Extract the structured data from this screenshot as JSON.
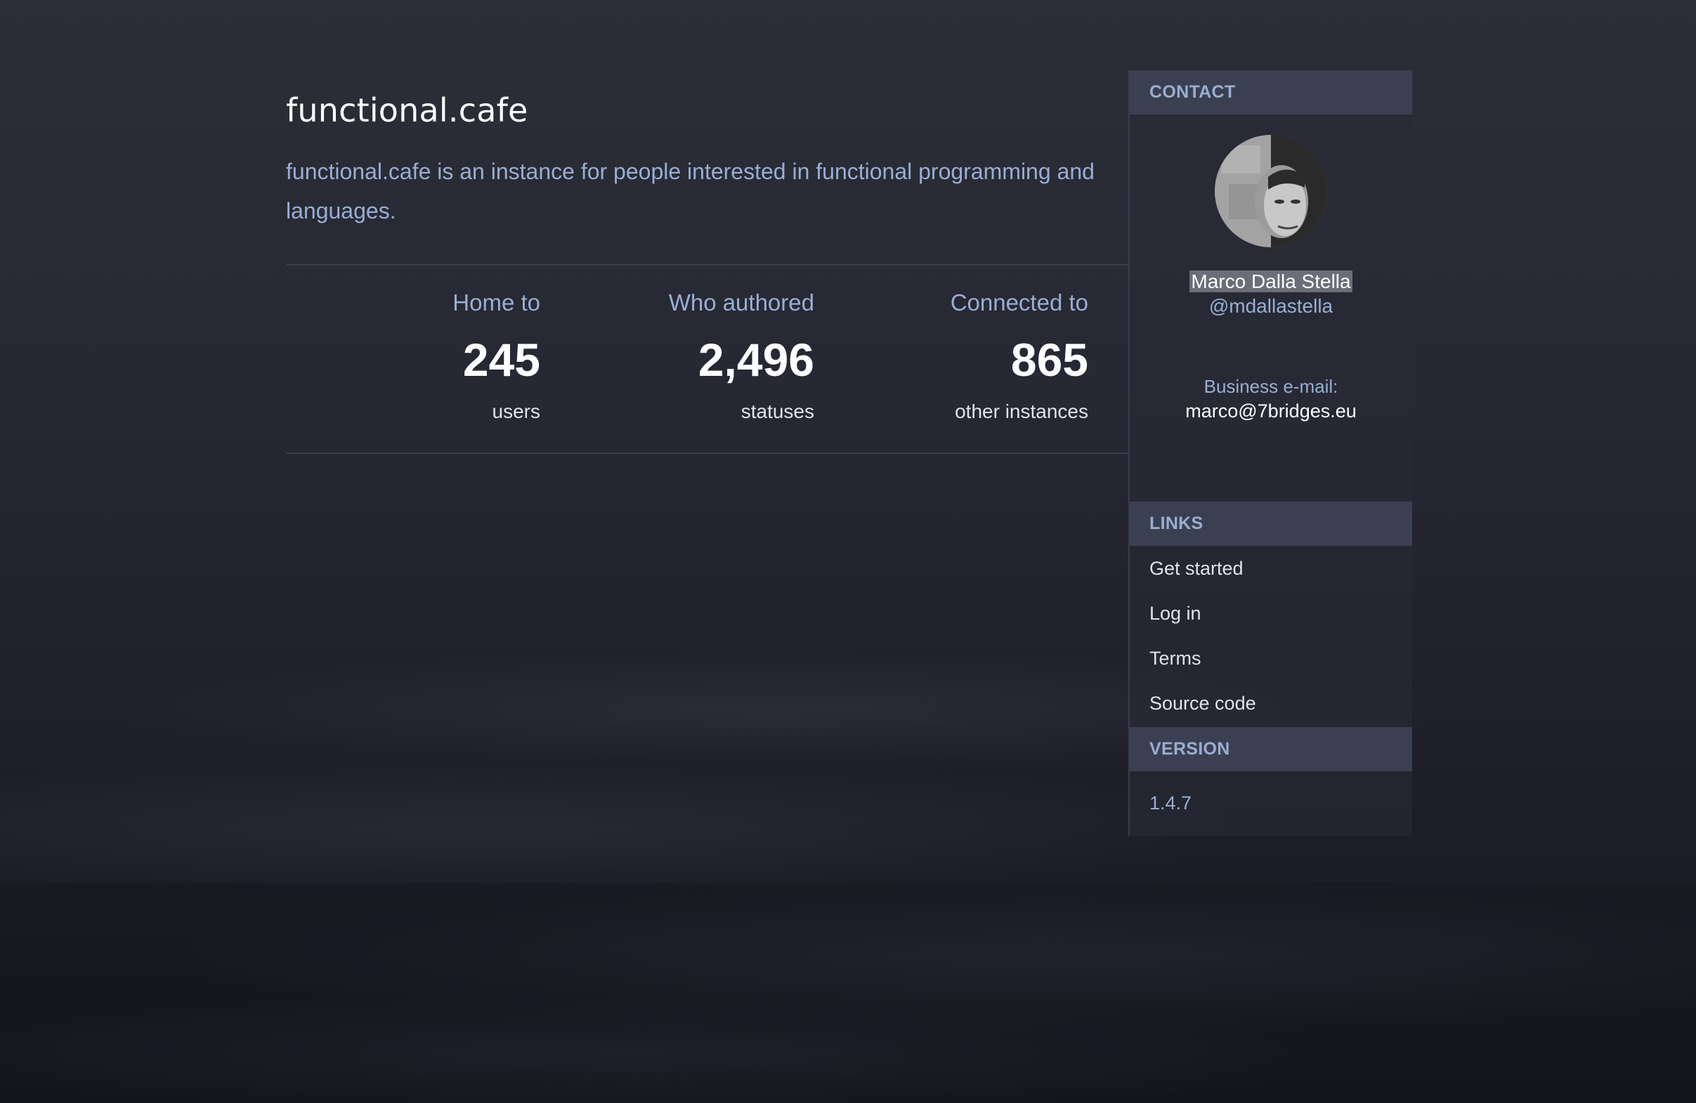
{
  "site": {
    "title": "functional.cafe",
    "description": "functional.cafe is an instance for people interested in functional programming and languages."
  },
  "stats": [
    {
      "label": "Home to",
      "value": "245",
      "unit": "users"
    },
    {
      "label": "Who authored",
      "value": "2,496",
      "unit": "statuses"
    },
    {
      "label": "Connected to",
      "value": "865",
      "unit": "other instances"
    }
  ],
  "sidebar": {
    "contact_header": "CONTACT",
    "contact": {
      "name": "Marco Dalla Stella",
      "handle": "@mdallastella",
      "email_label": "Business e-mail:",
      "email": "marco@7bridges.eu"
    },
    "links_header": "LINKS",
    "links": [
      "Get started",
      "Log in",
      "Terms",
      "Source code"
    ],
    "version_header": "VERSION",
    "version": "1.4.7"
  },
  "colors": {
    "accent_text": "#9aaed2",
    "panel_header_bg": "#3b3f52",
    "background": "#262833"
  }
}
